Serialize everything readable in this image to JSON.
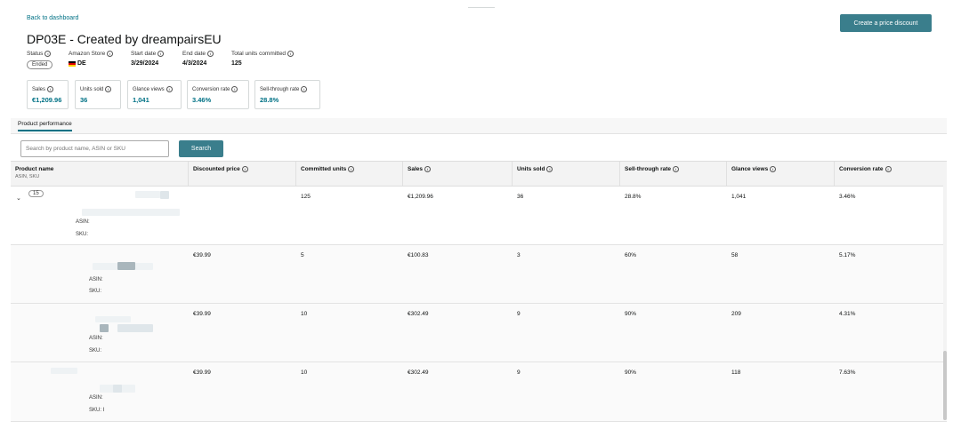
{
  "header": {
    "back_link": "Back to dashboard",
    "title": "DP03E - Created by dreampairsEU",
    "create_button": "Create a price discount"
  },
  "meta": {
    "status": {
      "label": "Status",
      "value": "Ended"
    },
    "store": {
      "label": "Amazon Store",
      "value": "DE"
    },
    "start_date": {
      "label": "Start date",
      "value": "3/29/2024"
    },
    "end_date": {
      "label": "End date",
      "value": "4/3/2024"
    },
    "total_units": {
      "label": "Total units committed",
      "value": "125"
    }
  },
  "metrics": [
    {
      "label": "Sales",
      "value": "€1,209.96"
    },
    {
      "label": "Units sold",
      "value": "36"
    },
    {
      "label": "Glance views",
      "value": "1,041"
    },
    {
      "label": "Conversion rate",
      "value": "3.46%"
    },
    {
      "label": "Sell-through rate",
      "value": "28.8%"
    }
  ],
  "tabs": {
    "active": "Product performance"
  },
  "search": {
    "placeholder": "Search by product name, ASIN or SKU",
    "button": "Search"
  },
  "table": {
    "headers": {
      "product": "Product name",
      "product_sub": "ASIN, SKU",
      "discounted_price": "Discounted price",
      "committed_units": "Committed units",
      "sales": "Sales",
      "units_sold": "Units sold",
      "sell_through": "Sell-through rate",
      "glance_views": "Glance views",
      "conversion": "Conversion rate"
    },
    "asin_label": "ASIN:",
    "sku_label": "SKU:",
    "sku_label_last": "SKU: I",
    "parent": {
      "count": "15",
      "discounted_price": "",
      "committed_units": "125",
      "sales": "€1,209.96",
      "units_sold": "36",
      "sell_through": "28.8%",
      "glance_views": "1,041",
      "conversion": "3.46%"
    },
    "rows": [
      {
        "discounted_price": "€39.99",
        "committed_units": "5",
        "sales": "€100.83",
        "units_sold": "3",
        "sell_through": "60%",
        "glance_views": "58",
        "conversion": "5.17%"
      },
      {
        "discounted_price": "€39.99",
        "committed_units": "10",
        "sales": "€302.49",
        "units_sold": "9",
        "sell_through": "90%",
        "glance_views": "209",
        "conversion": "4.31%"
      },
      {
        "discounted_price": "€39.99",
        "committed_units": "10",
        "sales": "€302.49",
        "units_sold": "9",
        "sell_through": "90%",
        "glance_views": "118",
        "conversion": "7.63%"
      }
    ]
  },
  "icons": {
    "info": "info-circle-icon",
    "caret": "chevron-down-icon",
    "flag": "germany-flag-icon"
  }
}
